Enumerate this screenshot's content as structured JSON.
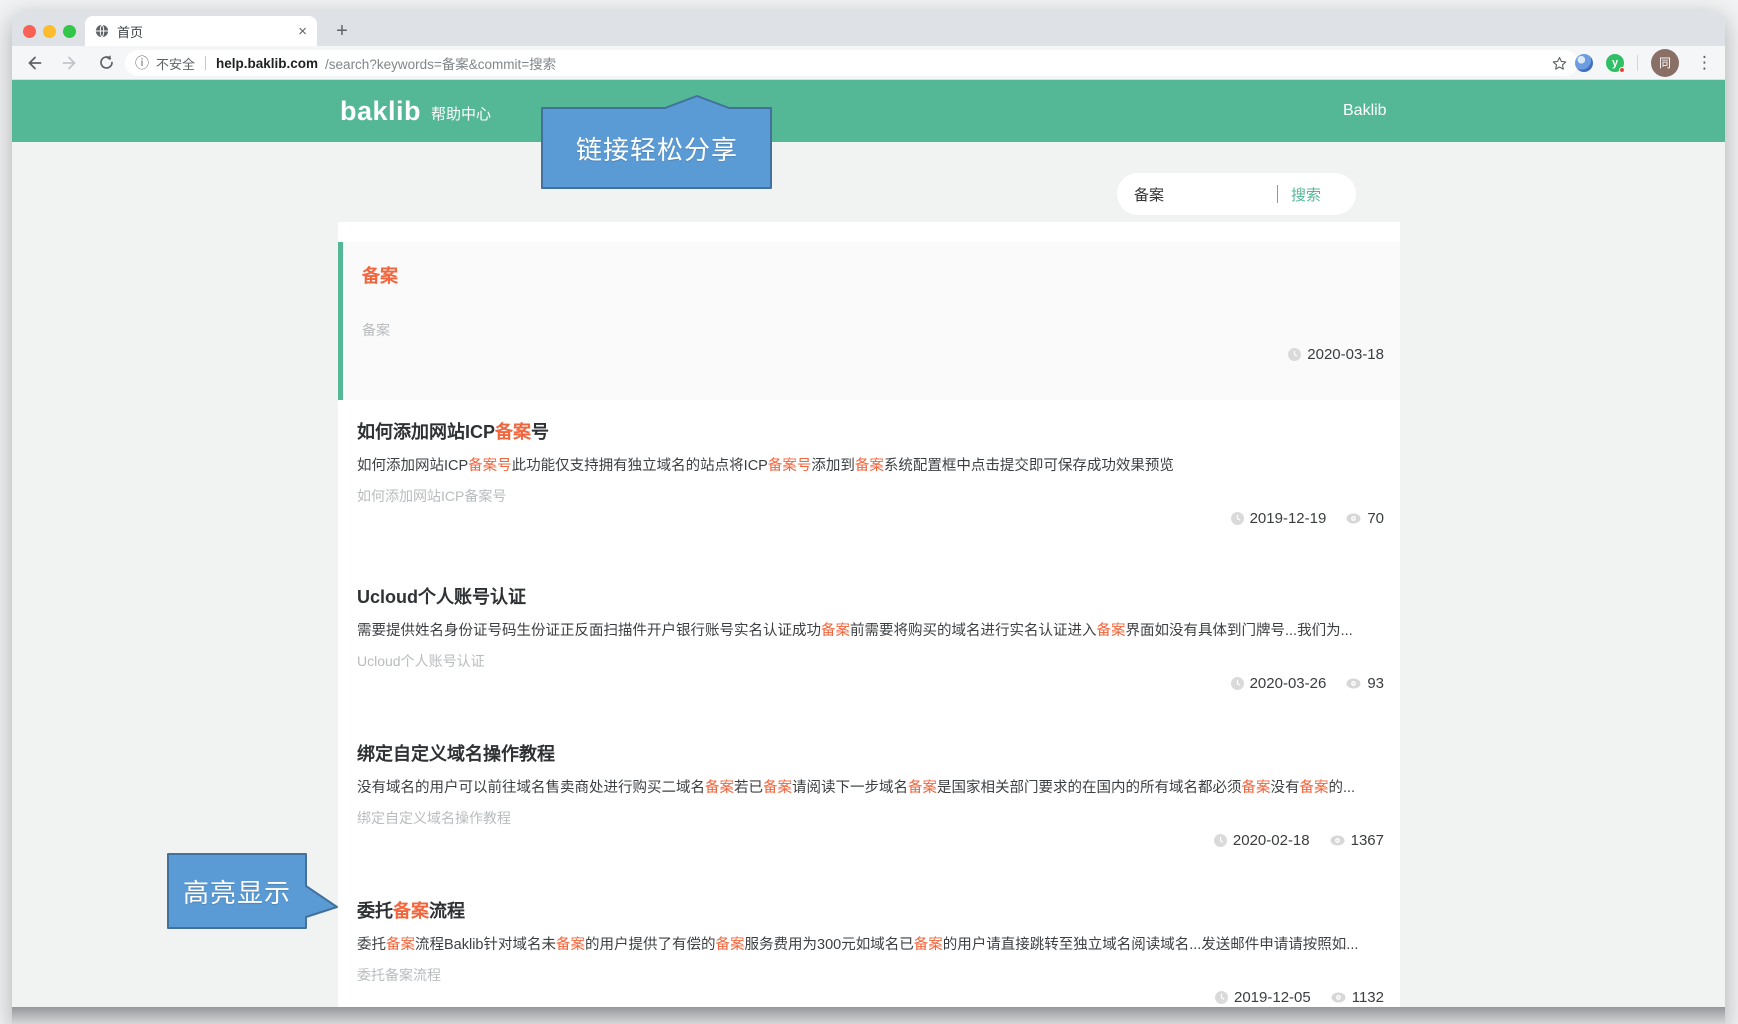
{
  "browser": {
    "tab_title": "首页",
    "security_label": "不安全",
    "url_host": "help.baklib.com",
    "url_path": "/search?keywords=备案&commit=搜索",
    "avatar_glyph": "同",
    "ext_green_glyph": "y",
    "icons": {
      "close": "×",
      "new_tab": "+",
      "info": "ⓘ",
      "menu": "⋮"
    }
  },
  "header": {
    "logo": "baklib",
    "logo_suffix": "帮助中心",
    "nav_link": "Baklib"
  },
  "annotations": {
    "share": "链接轻松分享",
    "highlight": "高亮显示"
  },
  "search": {
    "value": "备案",
    "submit_label": "搜索"
  },
  "featured": {
    "title": "备案",
    "subtitle": "备案",
    "date": "2020-03-18"
  },
  "results": [
    {
      "title": [
        {
          "t": "如何添加网站ICP"
        },
        {
          "t": "备案",
          "h": 1
        },
        {
          "t": "号"
        }
      ],
      "desc": [
        {
          "t": "如何添加网站ICP"
        },
        {
          "t": "备案号",
          "h": 1
        },
        {
          "t": "此功能仅支持拥有独立域名的站点将ICP"
        },
        {
          "t": "备案号",
          "h": 1
        },
        {
          "t": "添加到"
        },
        {
          "t": "备案",
          "h": 1
        },
        {
          "t": "系统配置框中点击提交即可保存成功效果预览"
        }
      ],
      "subtitle": "如何添加网站ICP备案号",
      "date": "2019-12-19",
      "views": "70"
    },
    {
      "title": [
        {
          "t": "Ucloud个人账号认证"
        }
      ],
      "desc": [
        {
          "t": "需要提供姓名身份证号码生份证正反面扫描件开户银行账号实名认证成功"
        },
        {
          "t": "备案",
          "h": 1
        },
        {
          "t": "前需要将购买的域名进行实名认证进入"
        },
        {
          "t": "备案",
          "h": 1
        },
        {
          "t": "界面如没有具体到门牌号...我们为..."
        }
      ],
      "subtitle": "Ucloud个人账号认证",
      "date": "2020-03-26",
      "views": "93"
    },
    {
      "title": [
        {
          "t": "绑定自定义域名操作教程"
        }
      ],
      "desc": [
        {
          "t": "没有域名的用户可以前往域名售卖商处进行购买二域名"
        },
        {
          "t": "备案",
          "h": 1
        },
        {
          "t": "若已"
        },
        {
          "t": "备案",
          "h": 1
        },
        {
          "t": "请阅读下一步域名"
        },
        {
          "t": "备案",
          "h": 1
        },
        {
          "t": "是国家相关部门要求的在国内的所有域名都必须"
        },
        {
          "t": "备案",
          "h": 1
        },
        {
          "t": "没有"
        },
        {
          "t": "备案",
          "h": 1
        },
        {
          "t": "的..."
        }
      ],
      "subtitle": "绑定自定义域名操作教程",
      "date": "2020-02-18",
      "views": "1367"
    },
    {
      "title": [
        {
          "t": "委托"
        },
        {
          "t": "备案",
          "h": 1
        },
        {
          "t": "流程"
        }
      ],
      "desc": [
        {
          "t": "委托"
        },
        {
          "t": "备案",
          "h": 1
        },
        {
          "t": "流程Baklib针对域名未"
        },
        {
          "t": "备案",
          "h": 1
        },
        {
          "t": "的用户提供了有偿的"
        },
        {
          "t": "备案",
          "h": 1
        },
        {
          "t": "服务费用为300元如域名已"
        },
        {
          "t": "备案",
          "h": 1
        },
        {
          "t": "的用户请直接跳转至独立域名阅读域名...发送邮件申请请按照如..."
        }
      ],
      "subtitle": "委托备案流程",
      "date": "2019-12-05",
      "views": "1132"
    }
  ],
  "colors": {
    "accent": "#54b795",
    "highlight_text": "#f2653d",
    "callout_fill": "#5b9bd5",
    "callout_border": "#41719c"
  }
}
